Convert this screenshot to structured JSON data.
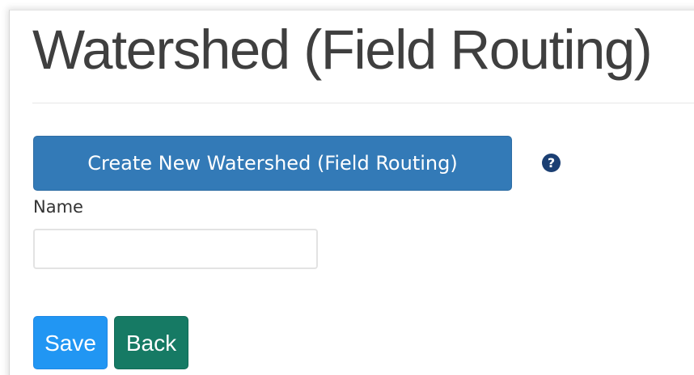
{
  "page": {
    "title": "Watershed (Field Routing)"
  },
  "actions": {
    "create_label": "Create New Watershed (Field Routing)",
    "help_symbol": "?"
  },
  "form": {
    "name_label": "Name",
    "name_value": "",
    "name_placeholder": ""
  },
  "footer": {
    "save_label": "Save",
    "back_label": "Back"
  },
  "colors": {
    "primary": "#337ab7",
    "save": "#2196f3",
    "back": "#167a64",
    "help_icon": "#1b3f73",
    "title_text": "#3f3f3f"
  },
  "icons": {
    "help": "question-circle-icon"
  }
}
